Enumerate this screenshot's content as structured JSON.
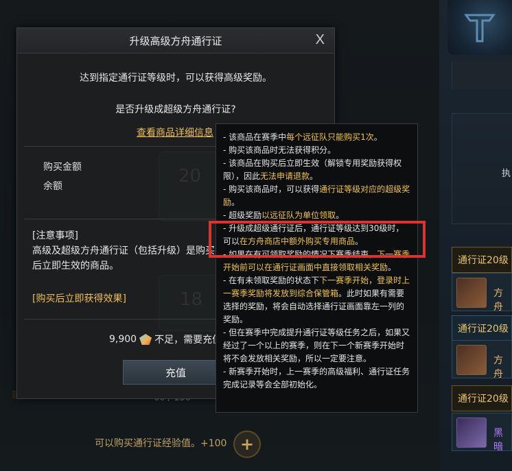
{
  "dialog": {
    "title": "升级高级方舟通行证",
    "close": "X",
    "line1": "达到指定通行证等级时，可以获得高级奖励。",
    "line2": "是否升级成超级方舟通行证?",
    "detail_link": "查看商品详细信息",
    "purchase_amount_label": "购买金额",
    "balance_label": "余额",
    "ghost_number_top": "20",
    "ghost_number_bottom": "18",
    "notice_header": "[注意事项]",
    "notice_body": "高级及超级方舟通行证（包括升级）是购买后立即生效的商品。",
    "notice_effect": "[购买后立即获得效果]",
    "cost_amount": "9,900",
    "cost_suffix": "不足，需要充值",
    "charge_button": "充值"
  },
  "tooltip": {
    "items": [
      {
        "parts": [
          {
            "t": "- 该商品在赛季中"
          },
          {
            "t": "每个远征队只能购买1次",
            "hl": true
          },
          {
            "t": "。"
          }
        ]
      },
      {
        "parts": [
          {
            "t": "- 购买该商品时无法获得积分。"
          }
        ]
      },
      {
        "parts": [
          {
            "t": "- 该商品在购买后立即生效（解锁专用奖励获得权限），因此"
          },
          {
            "t": "无法申请退款",
            "hl": true
          },
          {
            "t": "。"
          }
        ]
      },
      {
        "parts": [
          {
            "t": "- 购买该商品时，可以获得"
          },
          {
            "t": "通行证等级对应的超级奖励",
            "hl": true
          },
          {
            "t": "。"
          }
        ]
      },
      {
        "parts": [
          {
            "t": "- 超级奖励"
          },
          {
            "t": "以远征队为单位领取",
            "hl": true
          },
          {
            "t": "。"
          }
        ]
      },
      {
        "parts": [
          {
            "t": "- 升级成超级通行证后，通行证等级达到30级时，可以"
          },
          {
            "t": "在方舟商店中额外购买专用商品",
            "hl": true
          },
          {
            "t": "。"
          }
        ]
      },
      {
        "parts": [
          {
            "t": "- 如果在有可领取奖励的情况下赛季结束，"
          },
          {
            "t": "下一赛季开始前可以在通行证画面中直接领取相关奖励",
            "hl": true
          },
          {
            "t": "。"
          }
        ]
      },
      {
        "parts": [
          {
            "t": "- 在有未领取奖励的状态下"
          },
          {
            "t": "下一赛季开始，登录时上一赛季奖励将发放到综合保管箱",
            "hl": true
          },
          {
            "t": "。此时如果有需要选择的奖励，将会自动选择通行证画面靠左一列的奖励。"
          }
        ]
      },
      {
        "parts": [
          {
            "t": "- 但在赛季中完成提升通行证等级任务之后，如果又经过了一个以上的赛季，则在下一个新赛季开始时将不会发放相关奖励，所以一定要注意。"
          }
        ]
      },
      {
        "parts": [
          {
            "t": "- 新赛季开始时，上一赛季的高级福利、通行证任务完成记录等会全部初始化。"
          }
        ]
      }
    ]
  },
  "background": {
    "progress_text": "60 / 150",
    "bottom_info": "可以购买通行证经验值。+100",
    "plus_button": "+",
    "right_box_text": "执",
    "pass_row_1": "通行证20级",
    "pass_row_2": "通行证20级",
    "pass_row_3": "通行证20级",
    "item_1": "方舟",
    "item_2": "方舟",
    "item_3": "黑暗"
  }
}
